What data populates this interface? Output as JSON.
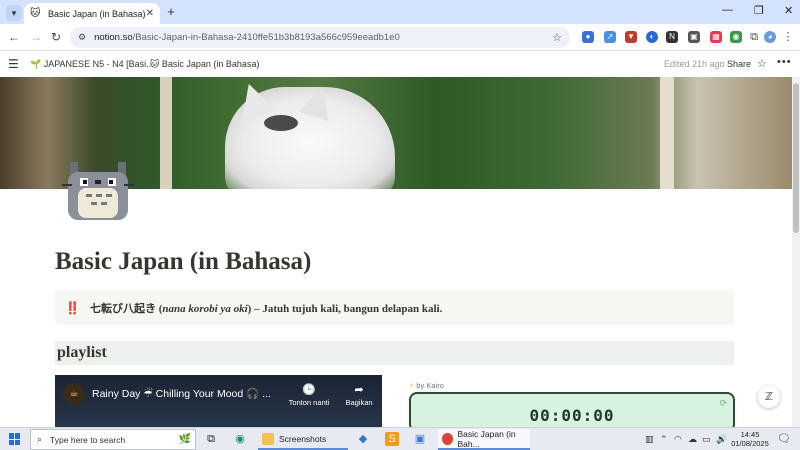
{
  "browser": {
    "tab_title": "Basic Japan (in Bahasa)",
    "url_host": "notion.so",
    "url_path": "/Basic-Japan-in-Bahasa-2410ffe51b3b8193a566c959eeadb1e0"
  },
  "notion_header": {
    "breadcrumb_parent": "JAPANESE N5 - N4 [Basi...",
    "breadcrumb_current": "Basic Japan (in Bahasa)",
    "edited": "Edited 21h ago",
    "share_label": "Share"
  },
  "page": {
    "title": "Basic Japan (in Bahasa)",
    "callout_icon": "‼️",
    "callout_jp": "七転び八起き",
    "callout_romaji": "nana korobi ya oki",
    "callout_rest": "– Jatuh tujuh kali, bangun delapan kali.",
    "playlist_heading": "playlist"
  },
  "video": {
    "title": "Rainy Day ☔ Chilling Your Mood 🎧 ...",
    "watch_later": "Tonton nanti",
    "share": "Bagikan"
  },
  "kairo": {
    "credit": "by Kairo",
    "timer": "00:00:00"
  },
  "taskbar": {
    "search_placeholder": "Type here to search",
    "app_screenshots": "Screenshots",
    "app_chrome": "Basic Japan (in Bah...",
    "time": "14:45",
    "date": "01/08/2025"
  },
  "colors": {
    "accent_blue": "#1f6fd6",
    "callout_bg": "#f7f6f3",
    "heading_bg": "#edf0ec",
    "timer_bg": "#d7f2df"
  }
}
